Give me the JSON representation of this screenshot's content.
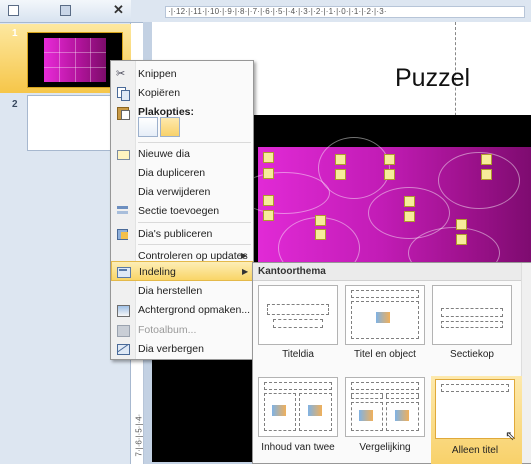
{
  "pane": {
    "slides": [
      {
        "number": "1",
        "selected": true
      },
      {
        "number": "2",
        "selected": false
      }
    ],
    "close_glyph": "✕"
  },
  "ruler": {
    "horizontal": "·|·12·|·11·|·10·|·9·|·8·|·7·|·6·|·5·|·4·|·3·|·2·|·1·|·0·|·1·|·2·|·3·",
    "vertical": "7·|·6·|·5·|·4·"
  },
  "slide": {
    "title": "Puzzel"
  },
  "context_menu": {
    "items": [
      {
        "label": "Knippen",
        "icon": "scissors-icon"
      },
      {
        "label": "Kopiëren",
        "icon": "copy-icon"
      },
      {
        "label": "Plakopties:",
        "icon": "paste-icon"
      },
      {
        "label": "Nieuwe dia",
        "icon": "new-slide-icon"
      },
      {
        "label": "Dia dupliceren",
        "icon": ""
      },
      {
        "label": "Dia verwijderen",
        "icon": ""
      },
      {
        "label": "Sectie toevoegen",
        "icon": "section-icon"
      },
      {
        "label": "Dia's publiceren",
        "icon": "publish-icon"
      },
      {
        "label": "Controleren op updates",
        "icon": ""
      },
      {
        "label": "Indeling",
        "icon": "layout-icon"
      },
      {
        "label": "Dia herstellen",
        "icon": ""
      },
      {
        "label": "Achtergrond opmaken...",
        "icon": "background-icon"
      },
      {
        "label": "Fotoalbum...",
        "icon": "photo-album-icon"
      },
      {
        "label": "Dia verbergen",
        "icon": "hide-slide-icon"
      }
    ],
    "submenu_arrow": "▶"
  },
  "layout_submenu": {
    "header": "Kantoorthema",
    "layouts": [
      {
        "label": "Titeldia"
      },
      {
        "label": "Titel en object"
      },
      {
        "label": "Sectiekop"
      },
      {
        "label": "Inhoud van twee"
      },
      {
        "label": "Vergelijking"
      },
      {
        "label": "Alleen titel",
        "selected": true
      }
    ]
  },
  "colors": {
    "accent_highlight": "#f9d567",
    "puzzle_pink": "#e12ad6",
    "puzzle_purple": "#7e0b70"
  }
}
